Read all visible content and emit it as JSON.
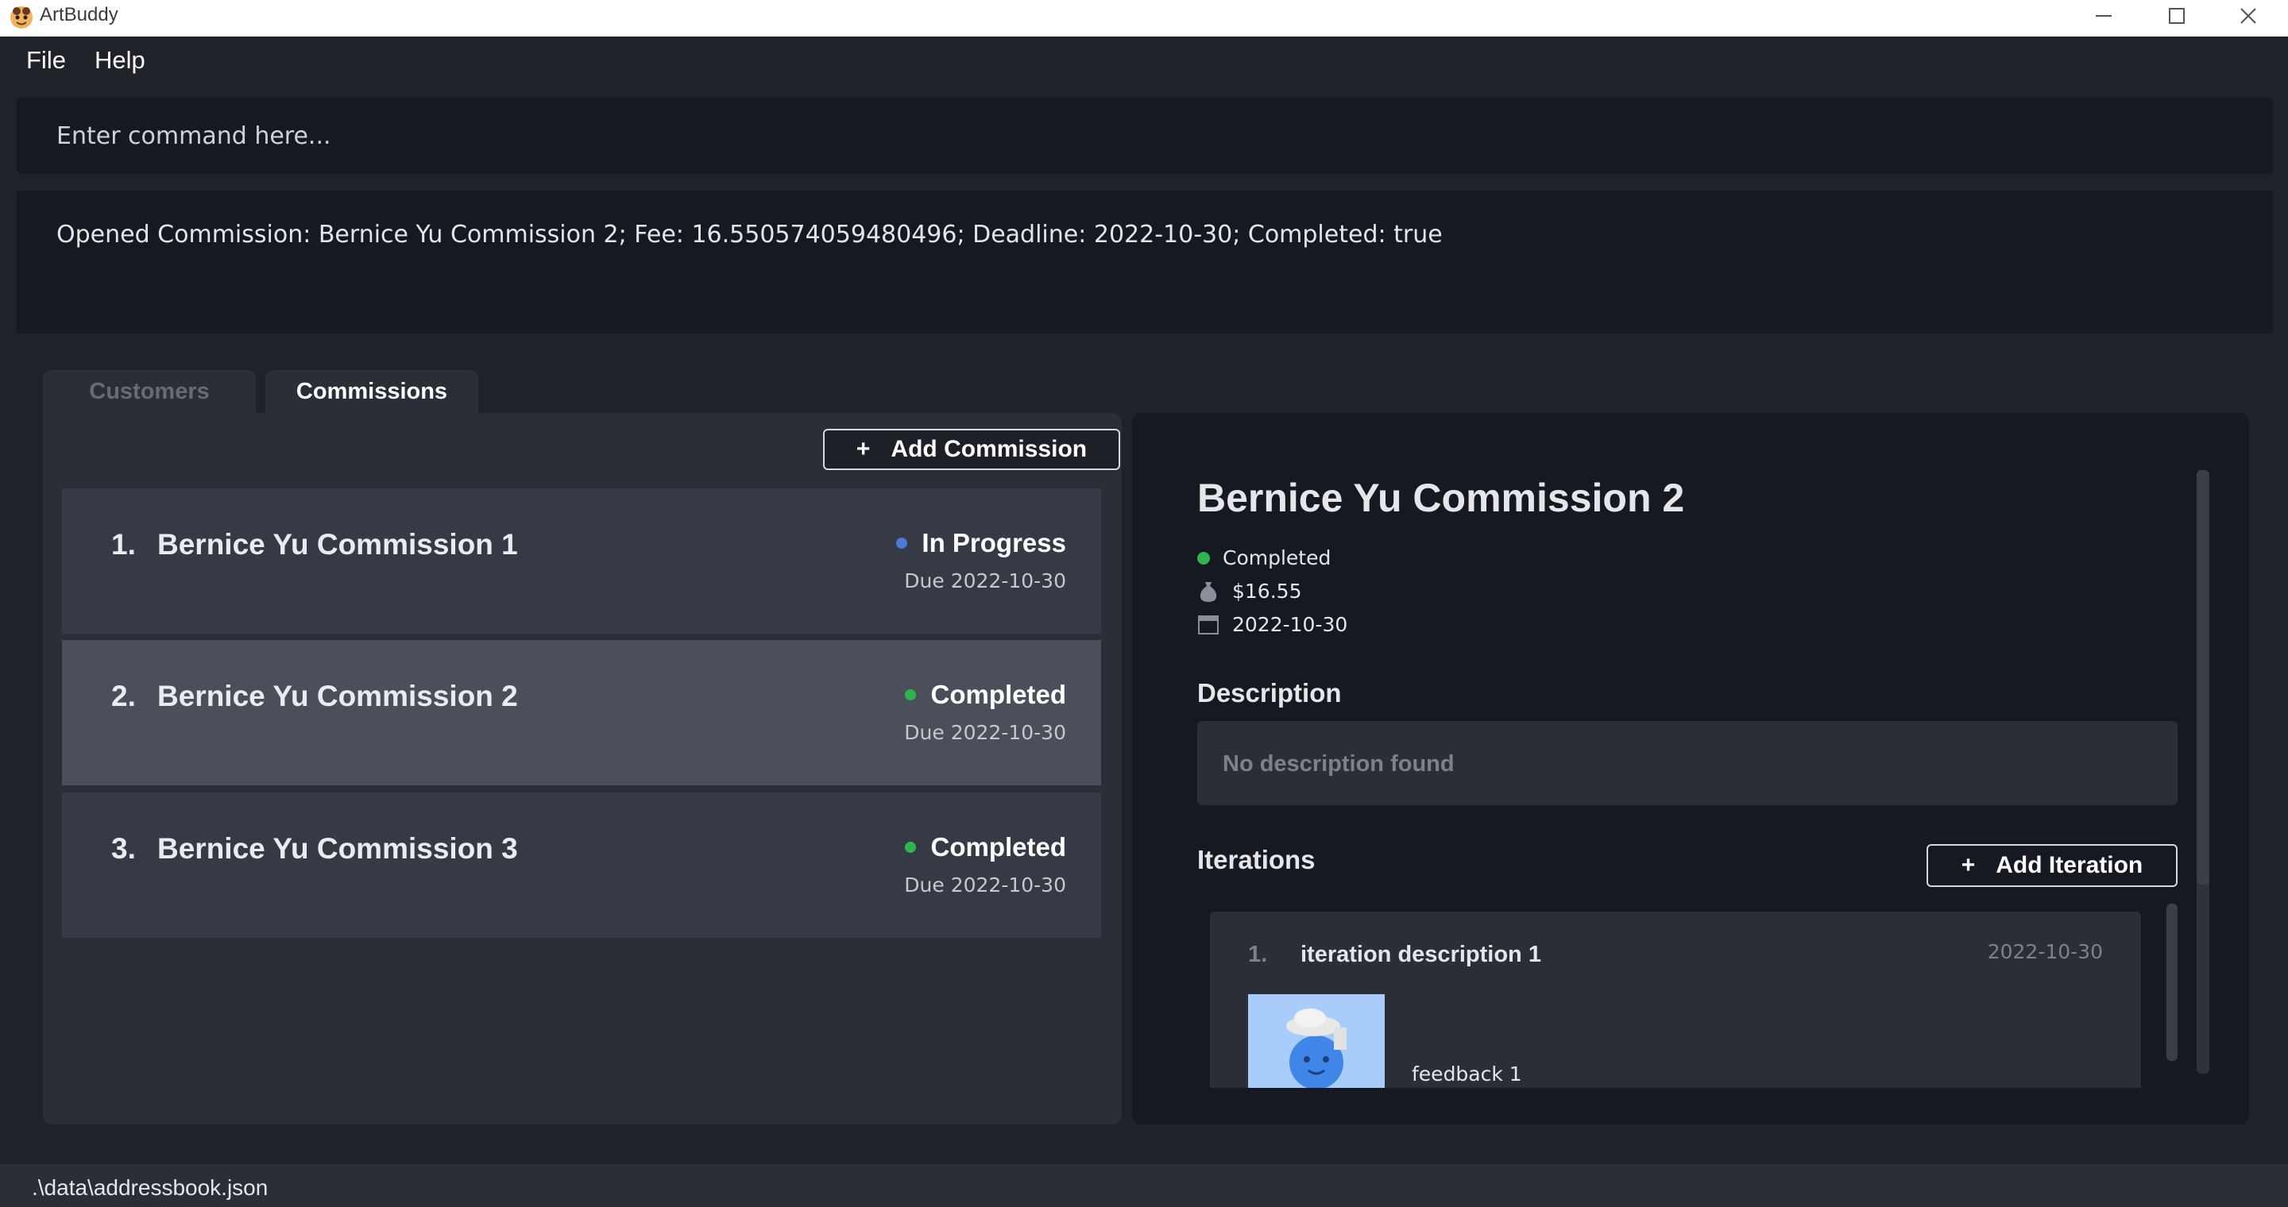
{
  "window": {
    "title": "ArtBuddy",
    "minimize_icon": "minimize-icon",
    "maximize_icon": "maximize-icon",
    "close_icon": "close-icon"
  },
  "menu": {
    "file": "File",
    "help": "Help"
  },
  "command": {
    "placeholder": "Enter command here..."
  },
  "result": {
    "text": "Opened Commission: Bernice Yu Commission 2; Fee: 16.550574059480496; Deadline: 2022-10-30; Completed: true"
  },
  "tabs": [
    {
      "label": "Customers",
      "active": false
    },
    {
      "label": "Commissions",
      "active": true
    }
  ],
  "commission_list": {
    "add_button": {
      "plus": "+",
      "label": "Add Commission"
    },
    "items": [
      {
        "index": "1.",
        "name": "Bernice Yu Commission 1",
        "status": "In Progress",
        "status_color": "#4c78d6",
        "due": "Due 2022-10-30",
        "selected": false
      },
      {
        "index": "2.",
        "name": "Bernice Yu Commission 2",
        "status": "Completed",
        "status_color": "#2fb54d",
        "due": "Due 2022-10-30",
        "selected": true
      },
      {
        "index": "3.",
        "name": "Bernice Yu Commission 3",
        "status": "Completed",
        "status_color": "#2fb54d",
        "due": "Due 2022-10-30",
        "selected": false
      }
    ]
  },
  "detail": {
    "title": "Bernice Yu Commission 2",
    "status": "Completed",
    "status_color": "#2fb54d",
    "fee": "$16.55",
    "fee_icon": "money-bag-icon",
    "deadline": "2022-10-30",
    "deadline_icon": "calendar-icon",
    "description_heading": "Description",
    "description": "No description found",
    "iterations_heading": "Iterations",
    "add_iteration": {
      "plus": "+",
      "label": "Add Iteration"
    },
    "iterations": [
      {
        "index": "1.",
        "description": "iteration description 1",
        "date": "2022-10-30",
        "feedback": "feedback 1",
        "image_icon": "character-illustration"
      }
    ]
  },
  "status_bar": {
    "path": ".\\data\\addressbook.json"
  },
  "colors": {
    "background": "#1f2229",
    "panel": "#2a2e36",
    "dark_panel": "#161921",
    "in_progress": "#4c78d6",
    "completed": "#2fb54d"
  }
}
